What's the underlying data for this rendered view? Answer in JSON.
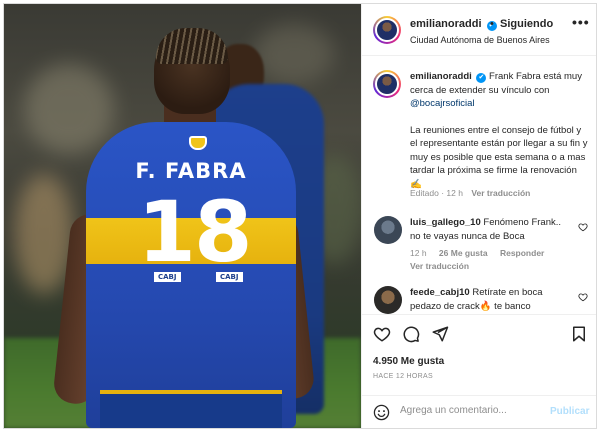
{
  "colors": {
    "accent": "#0095f6",
    "publish_disabled": "#b2dffc",
    "jersey_blue": "#2549b0",
    "jersey_gold": "#f0c419",
    "muted_text": "#8e8e8e",
    "mention": "#00376b"
  },
  "media": {
    "jersey_name": "F. FABRA",
    "jersey_number": "18",
    "sponsor_left": "CABJ",
    "sponsor_right": "CABJ"
  },
  "header": {
    "username": "emilianoraddi",
    "verified_icon": "✔",
    "separator": "•",
    "follow_status": "Siguiendo",
    "location": "Ciudad Autónoma de Buenos Aires",
    "more_icon": "•••"
  },
  "caption": {
    "username": "emilianoraddi",
    "text_part1": "Frank Fabra está muy cerca de extender su vínculo con",
    "mention": "@bocajrsoficial",
    "text_part2": "La reuniones entre el consejo de fútbol y el representante están por llegar a su fin y muy es posible que esta semana o a mas tardar la próxima se firme la renovación ✍️",
    "edited": "Editado · 12 h",
    "see_translation": "Ver traducción"
  },
  "comments": [
    {
      "username": "luis_gallego_10",
      "text": "Fenómeno Frank.. no te vayas nunca de Boca",
      "time": "12 h",
      "likes": "26 Me gusta",
      "reply": "Responder",
      "translation": "Ver traducción"
    },
    {
      "username": "feede_cabj10",
      "text": "Retírate en boca pedazo de crack🔥 te banco"
    }
  ],
  "actions": {
    "likes": "4.950 Me gusta",
    "time_ago": "HACE 12 HORAS",
    "comment_placeholder": "Agrega un comentario...",
    "publish": "Publicar"
  }
}
